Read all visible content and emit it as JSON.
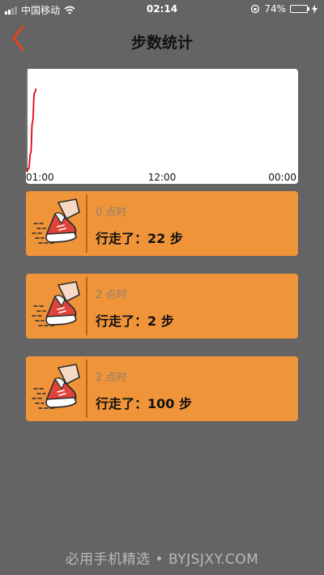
{
  "status_bar": {
    "carrier": "中国移动",
    "time": "02:14",
    "battery_percent": "74%",
    "battery_level": 0.74
  },
  "header": {
    "title": "步数统计"
  },
  "chart_data": {
    "type": "line",
    "x_ticks": [
      "01:00",
      "12:00",
      "00:00"
    ],
    "series": [
      {
        "x": [
          0,
          0.3,
          0.6,
          0.9,
          1.2,
          1.5
        ],
        "values": [
          0,
          4,
          22,
          60,
          95,
          100
        ]
      }
    ],
    "ylim": [
      0,
      124
    ],
    "xlim": [
      0,
      42
    ],
    "grid": false
  },
  "records": [
    {
      "hour_label": "0 点时",
      "steps_text": "行走了：22 步"
    },
    {
      "hour_label": "2 点时",
      "steps_text": "行走了：2 步"
    },
    {
      "hour_label": "2 点时",
      "steps_text": "行走了：100 步"
    }
  ],
  "icons": {
    "back": "chevron-left-icon",
    "record": "running-shoe-icon"
  },
  "colors": {
    "background": "#646464",
    "card": "#f0943a",
    "accent": "#e8411a",
    "chart_line": "#e60012"
  },
  "watermark": "必用手机精选 • BYJSJXY.COM"
}
